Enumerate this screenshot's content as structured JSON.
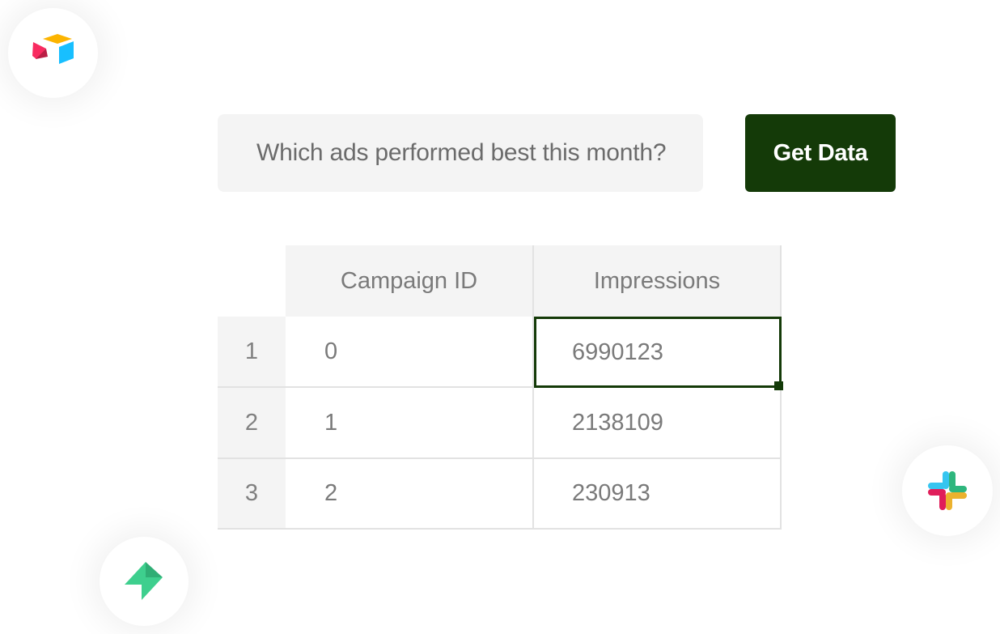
{
  "query": {
    "text": "Which ads performed best this month?"
  },
  "actions": {
    "get_data_label": "Get Data",
    "button_color": "#143a08"
  },
  "table": {
    "columns": [
      "Campaign ID",
      "Impressions"
    ],
    "rows": [
      {
        "row_number": "1",
        "campaign_id": "0",
        "impressions": "6990123"
      },
      {
        "row_number": "2",
        "campaign_id": "1",
        "impressions": "2138109"
      },
      {
        "row_number": "3",
        "campaign_id": "2",
        "impressions": "230913"
      }
    ],
    "selected_cell": "row 1, Impressions"
  },
  "integrations": [
    {
      "icon": "airtable-icon"
    },
    {
      "icon": "bolt-icon"
    },
    {
      "icon": "slack-icon"
    }
  ]
}
